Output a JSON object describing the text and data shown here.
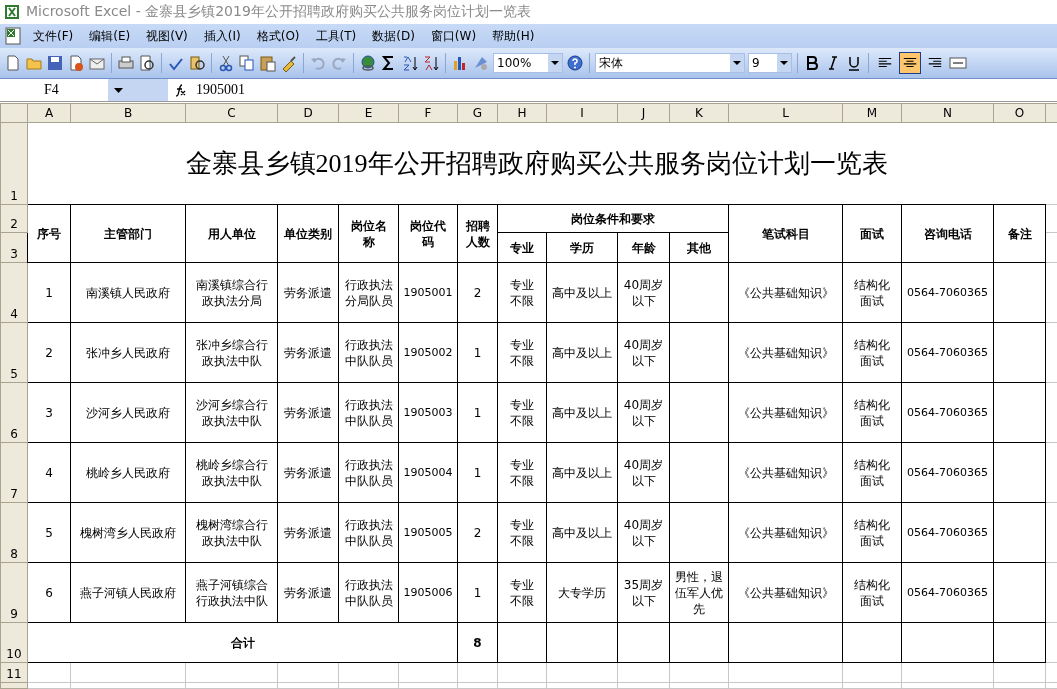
{
  "window": {
    "title": "Microsoft Excel - 金寨县乡镇2019年公开招聘政府购买公共服务岗位计划一览表"
  },
  "menu": [
    "文件(F)",
    "编辑(E)",
    "视图(V)",
    "插入(I)",
    "格式(O)",
    "工具(T)",
    "数据(D)",
    "窗口(W)",
    "帮助(H)"
  ],
  "toolbar": {
    "zoom": "100%",
    "font": "宋体",
    "font_size": "9",
    "align_buttons": [
      {
        "kind": "left",
        "selected": false
      },
      {
        "kind": "center",
        "selected": true
      },
      {
        "kind": "right",
        "selected": false
      }
    ]
  },
  "formula_bar": {
    "cell_ref": "F4",
    "value": "1905001"
  },
  "sheet": {
    "columns": [
      "A",
      "B",
      "C",
      "D",
      "E",
      "F",
      "G",
      "H",
      "I",
      "J",
      "K",
      "L",
      "M",
      "N",
      "O"
    ],
    "row_numbers": [
      "1",
      "2",
      "3",
      "4",
      "5",
      "6",
      "7",
      "8",
      "9",
      "10",
      "11"
    ],
    "title": "金寨县乡镇2019年公开招聘政府购买公共服务岗位计划一览表",
    "headers": [
      "序号",
      "主管部门",
      "用人单位",
      "单位类别",
      "岗位名称",
      "岗位代码",
      "招聘人数",
      "岗位条件和要求",
      "专业",
      "学历",
      "年龄",
      "其他",
      "笔试科目",
      "面试",
      "咨询电话",
      "备注"
    ],
    "rows": [
      {
        "seq": "1",
        "dept": "南溪镇人民政府",
        "unit": "南溪镇综合行政执法分局",
        "type": "劳务派遣",
        "post": "行政执法分局队员",
        "code": "1905001",
        "count": "2",
        "major": "专业不限",
        "edu": "高中及以上",
        "age": "40周岁以下",
        "exam": "《公共基础知识》",
        "interview": "结构化面试",
        "phone": "0564-7060365"
      },
      {
        "seq": "2",
        "dept": "张冲乡人民政府",
        "unit": "张冲乡综合行政执法中队",
        "type": "劳务派遣",
        "post": "行政执法中队队员",
        "code": "1905002",
        "count": "1",
        "major": "专业不限",
        "edu": "高中及以上",
        "age": "40周岁以下",
        "exam": "《公共基础知识》",
        "interview": "结构化面试",
        "phone": "0564-7060365"
      },
      {
        "seq": "3",
        "dept": "沙河乡人民政府",
        "unit": "沙河乡综合行政执法中队",
        "type": "劳务派遣",
        "post": "行政执法中队队员",
        "code": "1905003",
        "count": "1",
        "major": "专业不限",
        "edu": "高中及以上",
        "age": "40周岁以下",
        "exam": "《公共基础知识》",
        "interview": "结构化面试",
        "phone": "0564-7060365"
      },
      {
        "seq": "4",
        "dept": "桃岭乡人民政府",
        "unit": "桃岭乡综合行政执法中队",
        "type": "劳务派遣",
        "post": "行政执法中队队员",
        "code": "1905004",
        "count": "1",
        "major": "专业不限",
        "edu": "高中及以上",
        "age": "40周岁以下",
        "exam": "《公共基础知识》",
        "interview": "结构化面试",
        "phone": "0564-7060365"
      },
      {
        "seq": "5",
        "dept": "槐树湾乡人民政府",
        "unit": "槐树湾综合行政执法中队",
        "type": "劳务派遣",
        "post": "行政执法中队队员",
        "code": "1905005",
        "count": "2",
        "major": "专业不限",
        "edu": "高中及以上",
        "age": "40周岁以下",
        "exam": "《公共基础知识》",
        "interview": "结构化面试",
        "phone": "0564-7060365"
      },
      {
        "seq": "6",
        "dept": "燕子河镇人民政府",
        "unit": "燕子河镇综合行政执法中队",
        "type": "劳务派遣",
        "post": "行政执法中队队员",
        "code": "1905006",
        "count": "1",
        "major": "专业不限",
        "edu": "大专学历",
        "age": "35周岁以下",
        "other": "男性，退伍军人优先",
        "exam": "《公共基础知识》",
        "interview": "结构化面试",
        "phone": "0564-7060365"
      }
    ],
    "total": {
      "label": "合计",
      "count": "8"
    }
  }
}
